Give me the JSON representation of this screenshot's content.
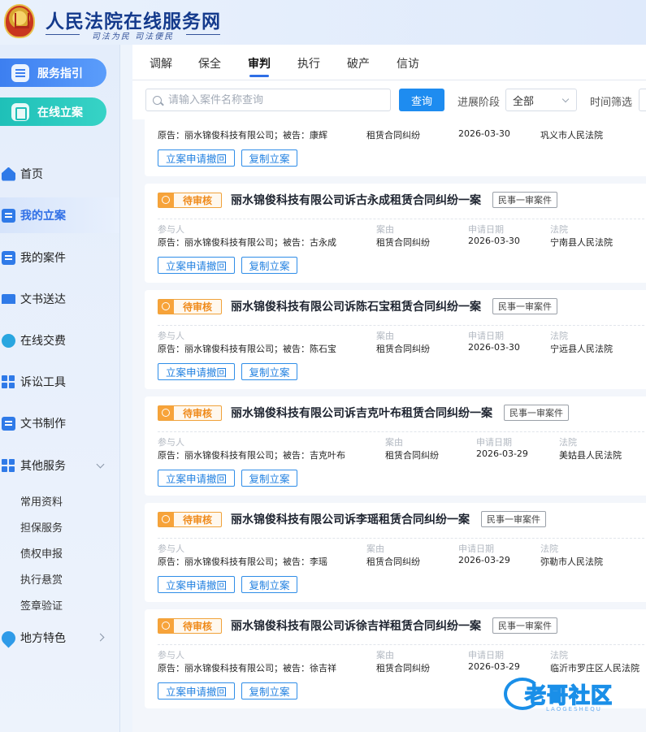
{
  "header": {
    "title": "人民法院在线服务网",
    "slogan": "司法为民  司法便民"
  },
  "sidebar": {
    "service_guide": "服务指引",
    "online_filing": "在线立案",
    "items": [
      {
        "label": "首页"
      },
      {
        "label": "我的立案"
      },
      {
        "label": "我的案件"
      },
      {
        "label": "文书送达"
      },
      {
        "label": "在线交费"
      },
      {
        "label": "诉讼工具"
      },
      {
        "label": "文书制作"
      },
      {
        "label": "其他服务"
      }
    ],
    "sub_items": [
      "常用资料",
      "担保服务",
      "债权申报",
      "执行悬赏",
      "签章验证"
    ],
    "regional": "地方特色"
  },
  "tabs": [
    "调解",
    "保全",
    "审判",
    "执行",
    "破产",
    "信访"
  ],
  "filters": {
    "search_placeholder": "请输入案件名称查询",
    "query_label": "查询",
    "stage_label": "进展阶段",
    "stage_value": "全部",
    "time_label": "时间筛选"
  },
  "cards": [
    {
      "status": "",
      "title": "",
      "type": "",
      "labels": {
        "party": "",
        "cause": "",
        "date": "",
        "court": ""
      },
      "party": "原告：丽水锦俊科技有限公司；被告：康辉",
      "cause": "租赁合同纠纷",
      "date": "2026-03-30",
      "court": "巩义市人民法院",
      "btn_withdraw": "立案申请撤回",
      "btn_copy": "复制立案"
    },
    {
      "status": "待审核",
      "title": "丽水锦俊科技有限公司诉古永成租赁合同纠纷一案",
      "type": "民事一审案件",
      "labels": {
        "party": "参与人",
        "cause": "案由",
        "date": "申请日期",
        "court": "法院"
      },
      "party": "原告：丽水锦俊科技有限公司；被告：古永成",
      "cause": "租赁合同纠纷",
      "date": "2026-03-30",
      "court": "宁南县人民法院",
      "btn_withdraw": "立案申请撤回",
      "btn_copy": "复制立案"
    },
    {
      "status": "待审核",
      "title": "丽水锦俊科技有限公司诉陈石宝租赁合同纠纷一案",
      "type": "民事一审案件",
      "labels": {
        "party": "参与人",
        "cause": "案由",
        "date": "申请日期",
        "court": "法院"
      },
      "party": "原告：丽水锦俊科技有限公司；被告：陈石宝",
      "cause": "租赁合同纠纷",
      "date": "2026-03-30",
      "court": "宁远县人民法院",
      "btn_withdraw": "立案申请撤回",
      "btn_copy": "复制立案"
    },
    {
      "status": "待审核",
      "title": "丽水锦俊科技有限公司诉吉克叶布租赁合同纠纷一案",
      "type": "民事一审案件",
      "labels": {
        "party": "参与人",
        "cause": "案由",
        "date": "申请日期",
        "court": "法院"
      },
      "party": "原告：丽水锦俊科技有限公司；被告：吉克叶布",
      "cause": "租赁合同纠纷",
      "date": "2026-03-29",
      "court": "美姑县人民法院",
      "btn_withdraw": "立案申请撤回",
      "btn_copy": "复制立案"
    },
    {
      "status": "待审核",
      "title": "丽水锦俊科技有限公司诉李瑶租赁合同纠纷一案",
      "type": "民事一审案件",
      "labels": {
        "party": "参与人",
        "cause": "案由",
        "date": "申请日期",
        "court": "法院"
      },
      "party": "原告：丽水锦俊科技有限公司；被告：李瑶",
      "cause": "租赁合同纠纷",
      "date": "2026-03-29",
      "court": "弥勒市人民法院",
      "btn_withdraw": "立案申请撤回",
      "btn_copy": "复制立案"
    },
    {
      "status": "待审核",
      "title": "丽水锦俊科技有限公司诉徐吉祥租赁合同纠纷一案",
      "type": "民事一审案件",
      "labels": {
        "party": "参与人",
        "cause": "案由",
        "date": "申请日期",
        "court": "法院"
      },
      "party": "原告：丽水锦俊科技有限公司；被告：徐吉祥",
      "cause": "租赁合同纠纷",
      "date": "2026-03-29",
      "court": "临沂市罗庄区人民法院",
      "btn_withdraw": "立案申请撤回",
      "btn_copy": "复制立案"
    }
  ],
  "watermark": {
    "text": "老哥社区",
    "sub": "LAOGESHEQU"
  }
}
